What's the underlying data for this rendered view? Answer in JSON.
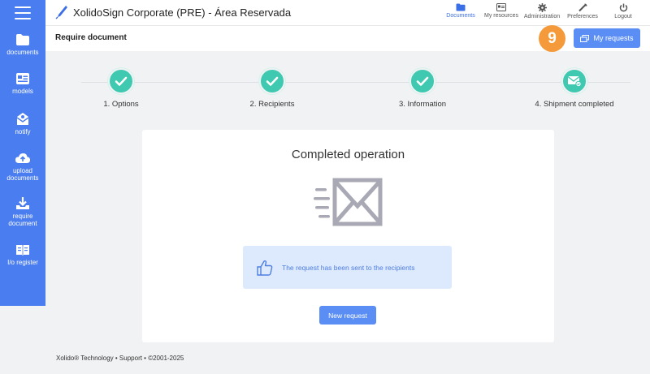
{
  "sidebar": {
    "items": [
      {
        "label": "documents"
      },
      {
        "label": "models"
      },
      {
        "label": "notify"
      },
      {
        "label": "upload\ndocuments"
      },
      {
        "label": "require\ndocument"
      },
      {
        "label": "I/o register"
      }
    ]
  },
  "topbar": {
    "title": "XolidoSign Corporate (PRE) - Área Reservada",
    "nav": [
      {
        "label": "Documents"
      },
      {
        "label": "My resources"
      },
      {
        "label": "Administration"
      },
      {
        "label": "Preferences"
      },
      {
        "label": "Logout"
      }
    ]
  },
  "header": {
    "title": "Require document",
    "badge": "9",
    "my_requests_label": "My requests"
  },
  "steps": [
    {
      "label": "1. Options"
    },
    {
      "label": "2. Recipients"
    },
    {
      "label": "3. Information"
    },
    {
      "label": "4. Shipment completed"
    }
  ],
  "card": {
    "title": "Completed operation",
    "info_text": "The request has been sent to the recipients",
    "new_request_label": "New request"
  },
  "footer": {
    "text": "Xolido® Technology  •  Support  •  ©2001-2025"
  },
  "colors": {
    "sidebar": "#4a7df0",
    "accent": "#5b8ef5",
    "step": "#3ec9b0",
    "badge": "#f59a3a",
    "info_bg": "#dde9fc"
  }
}
